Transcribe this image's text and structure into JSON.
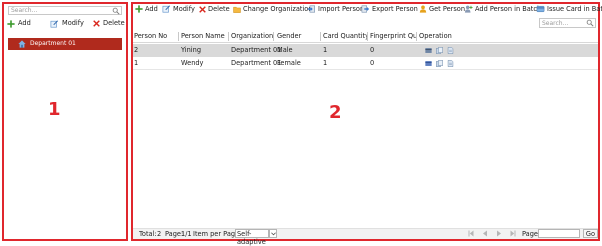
{
  "left_panel": {
    "search_placeholder": "Search...",
    "toolbar": {
      "add": "Add",
      "modify": "Modify",
      "delete": "Delete"
    },
    "tree": [
      {
        "label": "Department 01",
        "selected": true
      }
    ],
    "callout": "1"
  },
  "toolbar": {
    "add": "Add",
    "modify": "Modify",
    "delete": "Delete",
    "change_organization": "Change Organization",
    "import_person": "Import Person",
    "export_person": "Export Person",
    "get_person": "Get Person",
    "add_person_in_batch": "Add Person in Batch",
    "issue_card_in_batch": "Issue Card in Batch"
  },
  "search": {
    "placeholder": "Search..."
  },
  "table": {
    "columns": [
      "Person No",
      "Person Name",
      "Organization",
      "Gender",
      "Card Quantity",
      "Fingerprint Qua...",
      "Operation"
    ],
    "rows": [
      {
        "person_no": "2",
        "person_name": "Yining",
        "organization": "Department 01",
        "gender": "Male",
        "card_quantity": "1",
        "fingerprint_quantity": "0"
      },
      {
        "person_no": "1",
        "person_name": "Wendy",
        "organization": "Department 01",
        "gender": "Female",
        "card_quantity": "1",
        "fingerprint_quantity": "0"
      }
    ]
  },
  "callout": "2",
  "pagination": {
    "total_label": "Total:",
    "total": "2",
    "page_label": "Page:",
    "page": "1/1",
    "items_per_page_label": "Item per Page:",
    "items_per_page": "Self-adaptive",
    "page_input_label": "Page",
    "go": "Go"
  },
  "colors": {
    "callout_border": "#e0272d",
    "selected_tree_item": "#b02a1d",
    "add_icon": "#3c9a2c",
    "delete_icon": "#d9261c",
    "selected_row": "#d9d9d9"
  }
}
